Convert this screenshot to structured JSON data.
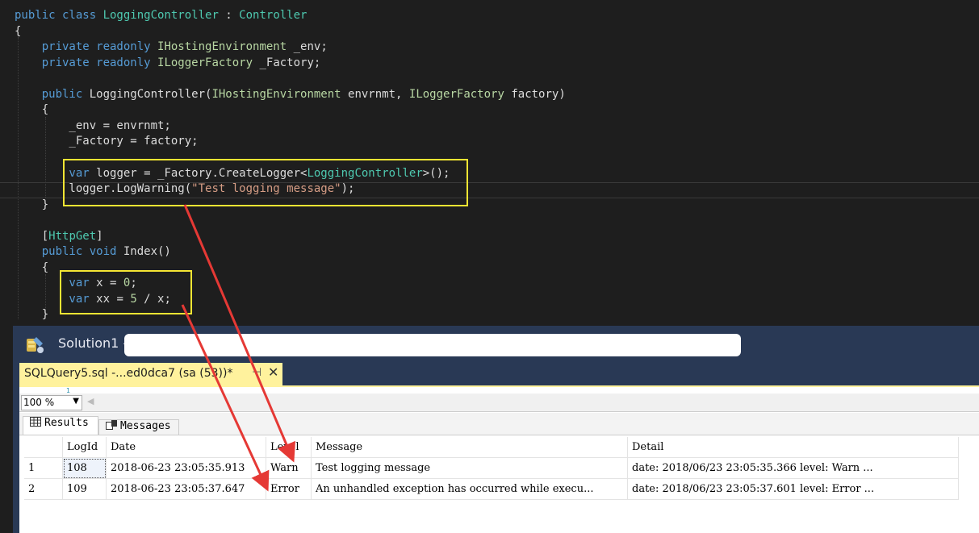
{
  "code": {
    "lines": [
      [
        {
          "t": "public class ",
          "c": "kw"
        },
        {
          "t": "LoggingController",
          "c": "ty"
        },
        {
          "t": " : ",
          "c": ""
        },
        {
          "t": "Controller",
          "c": "ty"
        }
      ],
      [
        {
          "t": "{",
          "c": ""
        }
      ],
      [
        {
          "t": "    private readonly ",
          "c": "kw"
        },
        {
          "t": "IHostingEnvironment",
          "c": "in"
        },
        {
          "t": " _env;",
          "c": ""
        }
      ],
      [
        {
          "t": "    private readonly ",
          "c": "kw"
        },
        {
          "t": "ILoggerFactory",
          "c": "in"
        },
        {
          "t": " _Factory;",
          "c": ""
        }
      ],
      [
        {
          "t": "",
          "c": ""
        }
      ],
      [
        {
          "t": "    public ",
          "c": "kw"
        },
        {
          "t": "LoggingController(",
          "c": ""
        },
        {
          "t": "IHostingEnvironment",
          "c": "in"
        },
        {
          "t": " envrnmt, ",
          "c": ""
        },
        {
          "t": "ILoggerFactory",
          "c": "in"
        },
        {
          "t": " factory)",
          "c": ""
        }
      ],
      [
        {
          "t": "    {",
          "c": ""
        }
      ],
      [
        {
          "t": "        _env = envrnmt;",
          "c": ""
        }
      ],
      [
        {
          "t": "        _Factory = factory;",
          "c": ""
        }
      ],
      [
        {
          "t": "",
          "c": ""
        }
      ],
      [
        {
          "t": "        var ",
          "c": "kw"
        },
        {
          "t": "logger = _Factory.CreateLogger<",
          "c": ""
        },
        {
          "t": "LoggingController",
          "c": "ty"
        },
        {
          "t": ">();",
          "c": ""
        }
      ],
      [
        {
          "t": "        logger.LogWarning(",
          "c": ""
        },
        {
          "t": "\"Test logging message\"",
          "c": "st"
        },
        {
          "t": ");",
          "c": ""
        }
      ],
      [
        {
          "t": "    }",
          "c": ""
        }
      ],
      [
        {
          "t": "",
          "c": ""
        }
      ],
      [
        {
          "t": "    [",
          "c": ""
        },
        {
          "t": "HttpGet",
          "c": "ty"
        },
        {
          "t": "]",
          "c": ""
        }
      ],
      [
        {
          "t": "    public void ",
          "c": "kw"
        },
        {
          "t": "Index()",
          "c": ""
        }
      ],
      [
        {
          "t": "    {",
          "c": ""
        }
      ],
      [
        {
          "t": "        var ",
          "c": "kw"
        },
        {
          "t": "x = ",
          "c": ""
        },
        {
          "t": "0",
          "c": "in"
        },
        {
          "t": ";",
          "c": ""
        }
      ],
      [
        {
          "t": "        var ",
          "c": "kw"
        },
        {
          "t": "xx = ",
          "c": ""
        },
        {
          "t": "5",
          "c": "in"
        },
        {
          "t": " / x;",
          "c": ""
        }
      ],
      [
        {
          "t": "    }",
          "c": ""
        }
      ]
    ]
  },
  "ssms": {
    "title": "Solution1 -",
    "doc_tab": "SQLQuery5.sql -...ed0dca7 (sa (53))*",
    "pin_glyph": "⊣",
    "close_glyph": "✕",
    "line_number": "1",
    "zoom": "100 %",
    "results_tab": "Results",
    "messages_tab": "Messages"
  },
  "grid": {
    "columns": [
      "LogId",
      "Date",
      "Level",
      "Message",
      "Detail"
    ],
    "rows": [
      {
        "n": "1",
        "LogId": "108",
        "Date": "2018-06-23 23:05:35.913",
        "Level": "Warn",
        "Message": "Test logging message",
        "Detail": "   date: 2018/06/23 23:05:35.366   level: Warn   ..."
      },
      {
        "n": "2",
        "LogId": "109",
        "Date": "2018-06-23 23:05:37.647",
        "Level": "Error",
        "Message": "An unhandled exception has occurred while execu...",
        "Detail": "   date: 2018/06/23 23:05:37.601   level: Error   ..."
      }
    ]
  },
  "colors": {
    "highlight": "#f5e533",
    "arrow": "#e53935"
  }
}
